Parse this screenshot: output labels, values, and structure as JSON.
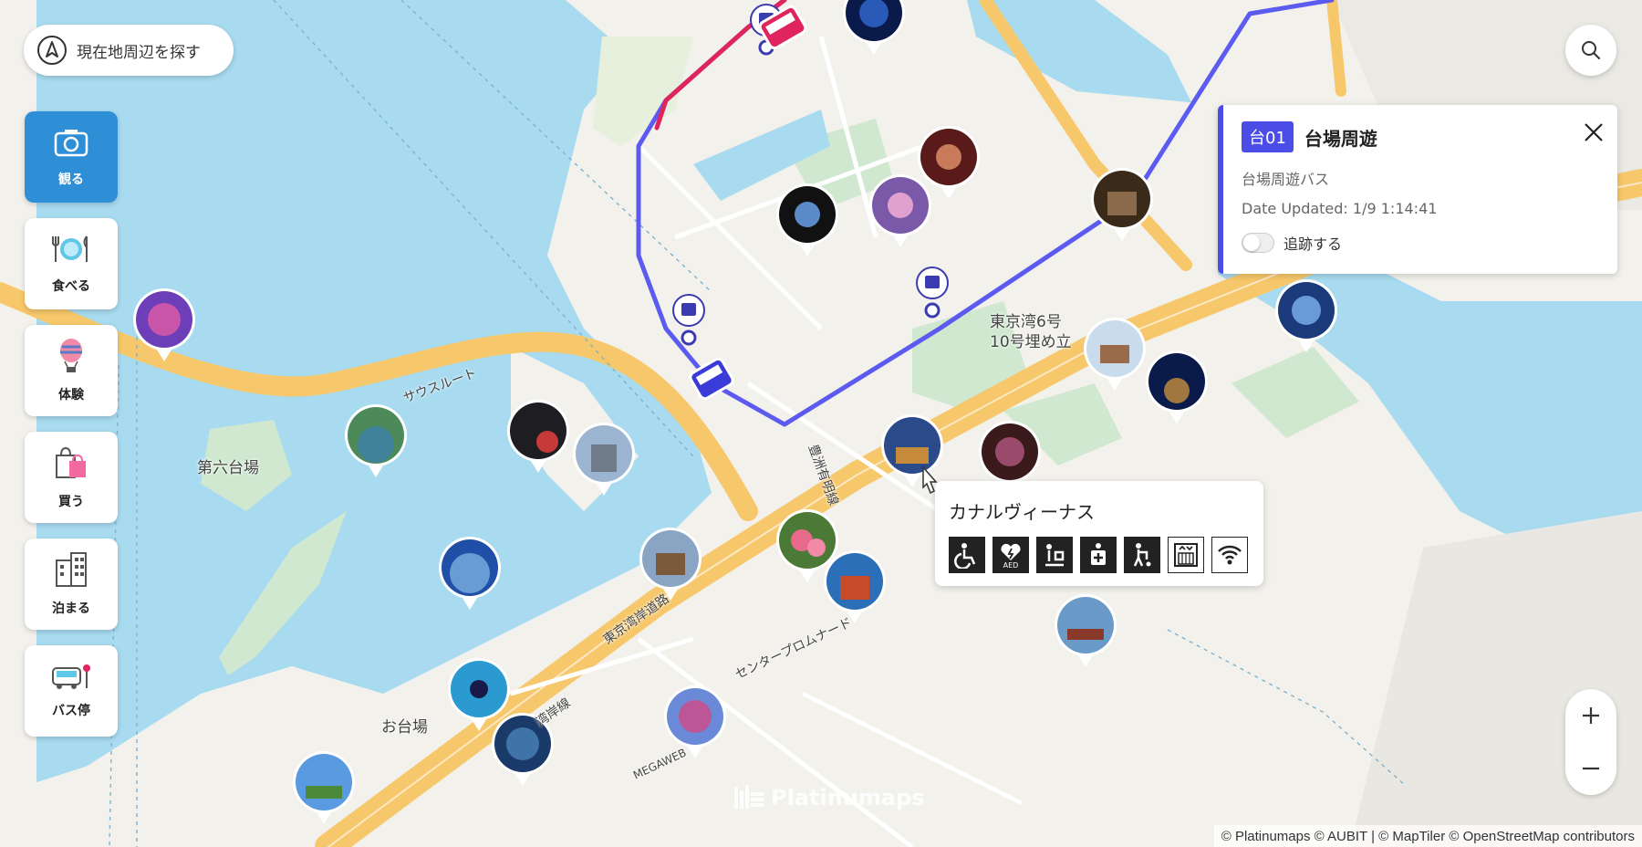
{
  "locate_button": {
    "label": "現在地周辺を探す"
  },
  "categories": [
    {
      "label": "観る",
      "icon": "camera-icon",
      "active": true
    },
    {
      "label": "食べる",
      "icon": "dining-icon",
      "active": false
    },
    {
      "label": "体験",
      "icon": "balloon-icon",
      "active": false
    },
    {
      "label": "買う",
      "icon": "shopping-bag-icon",
      "active": false
    },
    {
      "label": "泊まる",
      "icon": "hotel-icon",
      "active": false
    },
    {
      "label": "バス停",
      "icon": "bus-stop-icon",
      "active": false
    }
  ],
  "bus_info": {
    "route_id": "台01",
    "route_name": "台場周遊",
    "subtitle": "台場周遊バス",
    "date_updated": "Date Updated: 1/9 1:14:41",
    "track_label": "追跡する",
    "tracking": false
  },
  "spot_tooltip": {
    "title": "カナルヴィーナス",
    "facilities": [
      "wheelchair-icon",
      "aed-icon",
      "baby-care-icon",
      "first-aid-icon",
      "stroller-icon",
      "elevator-icon",
      "wifi-icon"
    ]
  },
  "map_labels": {
    "island": "第六台場",
    "odaiba": "お台場",
    "landfill": "東京湾6号\n10号埋め立",
    "south_route": "サウスルート",
    "bayshore_route": "東京湾岸道路",
    "wangan": "湾岸線",
    "center_promenade": "センタープロムナード",
    "yurikamome_ariake": "豊洲有明線",
    "megaweb": "MEGAWEB"
  },
  "brand": "Platinumaps",
  "attribution": "© Platinumaps © AUBIT | © MapTiler © OpenStreetMap contributors",
  "colors": {
    "accent": "#2f8fd6",
    "route": "#5b5bf0",
    "route_badge": "#4b4de6",
    "bus_red": "#e0245e",
    "water": "#a8dbf0",
    "land": "#f3f1ec",
    "park": "#cfe8cf",
    "road": "#f7c86b"
  }
}
